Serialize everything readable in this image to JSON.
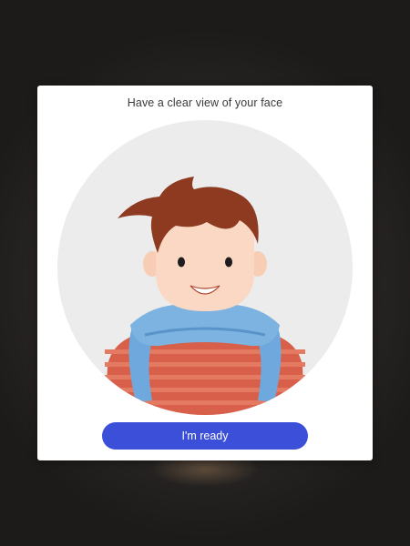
{
  "dialog": {
    "title": "Have a clear view of your face",
    "illustration_icon": "face-illustration-icon",
    "button_label": "I'm ready"
  },
  "colors": {
    "button": "#3b4fd8",
    "circle_background": "#ececed",
    "hair": "#8d3a20",
    "skin": "#fbd8c4",
    "scarf": "#6fa8dc",
    "sweater": "#d85f4a"
  }
}
